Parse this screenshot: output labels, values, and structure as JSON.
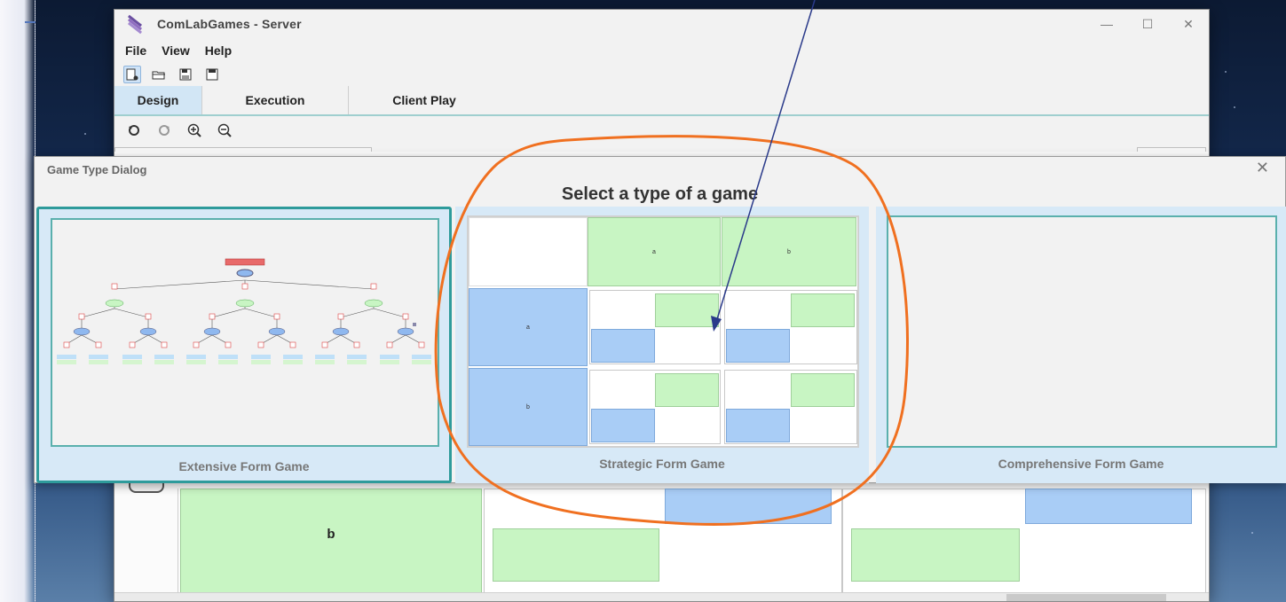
{
  "window": {
    "title": "ComLabGames - Server",
    "minimize": "—",
    "maximize": "☐",
    "close": "✕"
  },
  "menu": {
    "file": "File",
    "view": "View",
    "help": "Help"
  },
  "toolbar": {
    "new_icon": "new-game-icon",
    "open_icon": "open-folder-icon",
    "save_as_icon": "save-as-icon",
    "save_icon": "save-icon"
  },
  "tabs": {
    "design": "Design",
    "execution": "Execution",
    "client_play": "Client Play"
  },
  "design_toolbar": {
    "undo_icon": "undo-icon",
    "redo_icon": "redo-icon",
    "zoom_in_icon": "zoom-in-icon",
    "zoom_out_icon": "zoom-out-icon"
  },
  "canvas": {
    "row_label": "b"
  },
  "dialog": {
    "title": "Game Type Dialog",
    "close": "✕",
    "heading": "Select a type of a game",
    "options": {
      "extensive": "Extensive Form Game",
      "strategic": "Strategic Form Game",
      "comprehensive": "Comprehensive Form Game"
    },
    "strategic_preview": {
      "col_a": "a",
      "col_b": "b",
      "row_a": "a",
      "row_b": "b"
    }
  },
  "colors": {
    "annotation": "#f07020",
    "arrow": "#2a3a8a",
    "green_cell": "#c8f5c3",
    "blue_cell": "#a9cdf6",
    "selected_border": "#2e9b9b"
  }
}
